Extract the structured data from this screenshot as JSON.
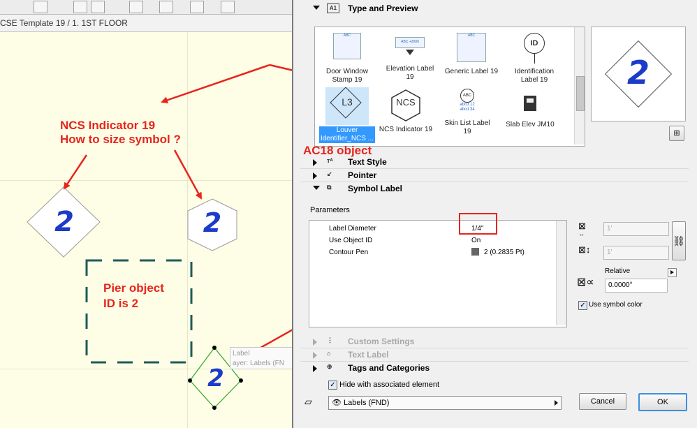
{
  "canvas": {
    "tab_title": "CSE Template 19 / 1. 1ST FLOOR",
    "symbols": [
      "2",
      "2",
      "2"
    ],
    "tooltip_line1": "Label",
    "tooltip_line2": "ayer: Labels (FN"
  },
  "annotations": {
    "ncs_title": "NCS Indicator 19",
    "ncs_question": "How to size symbol ?",
    "pier_line1": "Pier object",
    "pier_line2": "ID is 2",
    "ac18": "AC18 object"
  },
  "sections": {
    "type_preview": "Type and Preview",
    "text_style": "Text Style",
    "pointer": "Pointer",
    "symbol_label": "Symbol Label",
    "custom_settings": "Custom Settings",
    "text_label": "Text Label",
    "tags": "Tags and Categories"
  },
  "library": {
    "items": [
      {
        "line1": "Door Window",
        "line2": "Stamp 19"
      },
      {
        "line1": "Elevation Label",
        "line2": "19"
      },
      {
        "line1": "Generic Label 19",
        "line2": ""
      },
      {
        "line1": "Identification",
        "line2": "Label 19"
      },
      {
        "line1": "Louver",
        "line2": "Identifier_NCS ..."
      },
      {
        "line1": "NCS Indicator 19",
        "line2": ""
      },
      {
        "line1": "Skin List Label",
        "line2": "19"
      },
      {
        "line1": "Slab Elev JM10",
        "line2": ""
      }
    ],
    "icon_text": {
      "id": "ID",
      "l3": "L3",
      "ncs": "NCS",
      "abc": "ABC",
      "elev": "ABC +2000",
      "skin1": "abcd 12",
      "skin2": "abcd 34"
    }
  },
  "preview": {
    "text": "2"
  },
  "parameters": {
    "heading": "Parameters",
    "rows": [
      {
        "name": "Label Diameter",
        "value": "1/4\""
      },
      {
        "name": "Use Object ID",
        "value": "On"
      },
      {
        "name": "Contour Pen",
        "value": "2 (0.2835 Pt)"
      }
    ]
  },
  "side": {
    "width_value": "1'",
    "height_value": "1'",
    "relative": "Relative",
    "angle": "0.0000°",
    "use_symbol_color": "Use symbol color"
  },
  "bottom": {
    "hide_label": "Hide with associated element",
    "layer": "Labels (FND)",
    "cancel": "Cancel",
    "ok": "OK"
  }
}
